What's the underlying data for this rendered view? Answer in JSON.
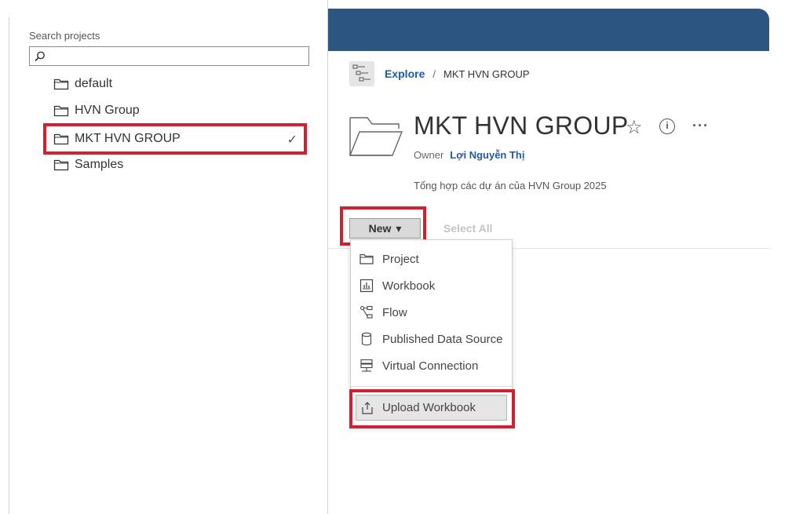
{
  "search": {
    "label": "Search projects",
    "value": "",
    "icon": "search-icon"
  },
  "tree": {
    "items": [
      {
        "label": "default",
        "icon": "folder-icon",
        "selected": false
      },
      {
        "label": "HVN Group",
        "icon": "folder-icon",
        "selected": false
      },
      {
        "label": "MKT HVN GROUP",
        "icon": "folder-icon",
        "selected": true,
        "checkmark": "✓"
      },
      {
        "label": "Samples",
        "icon": "folder-icon",
        "selected": false
      }
    ]
  },
  "breadcrumb": {
    "root": "Explore",
    "separator": "/",
    "current": "MKT HVN GROUP"
  },
  "project": {
    "title": "MKT HVN GROUP",
    "owner_label": "Owner",
    "owner_name": "Lợi Nguyễn Thị",
    "description": "Tổng hợp các dự án của HVN Group 2025",
    "star": "☆",
    "info": "i",
    "more": "···"
  },
  "toolbar": {
    "new_label": "New",
    "new_caret": "▾",
    "select_all_label": "Select All"
  },
  "new_menu": {
    "items": [
      {
        "label": "Project",
        "icon": "folder-icon"
      },
      {
        "label": "Workbook",
        "icon": "workbook-icon"
      },
      {
        "label": "Flow",
        "icon": "flow-icon"
      },
      {
        "label": "Published Data Source",
        "icon": "datasource-icon"
      },
      {
        "label": "Virtual Connection",
        "icon": "virtual-connection-icon"
      }
    ],
    "upload_label": "Upload Workbook",
    "upload_icon": "upload-icon"
  },
  "colors": {
    "banner": "#2d5582",
    "highlight": "#d12030",
    "link": "#1f5aa6"
  }
}
